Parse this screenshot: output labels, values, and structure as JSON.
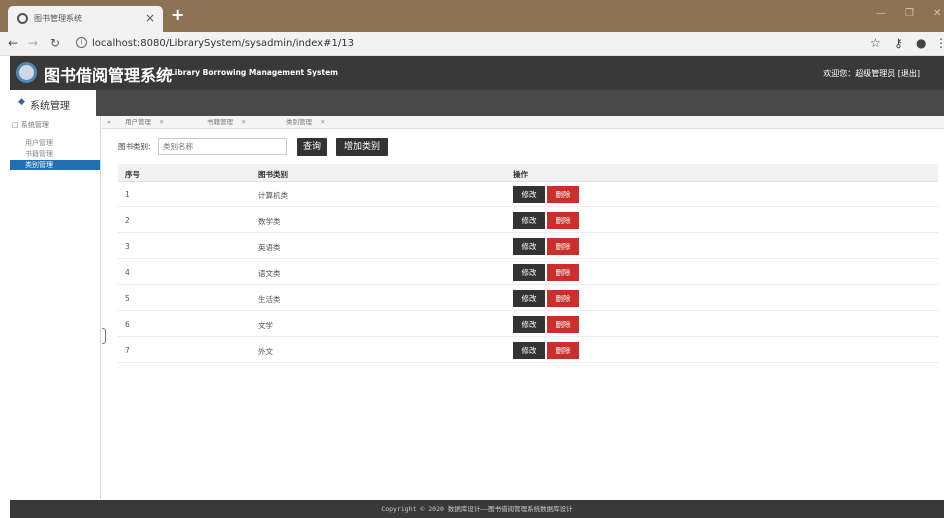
{
  "browser": {
    "tab_title": "图书管理系统",
    "url": "localhost:8080/LibrarySystem/sysadmin/index#1/13"
  },
  "app": {
    "title": "图书借阅管理系统",
    "subtitle": "Library Borrowing Management System",
    "welcome": "欢迎您：超级管理员 [退出]"
  },
  "topnav": {
    "label": "系统管理"
  },
  "sidebar": {
    "group": "系统管理",
    "items": [
      {
        "label": "用户管理"
      },
      {
        "label": "书籍管理"
      },
      {
        "label": "类别管理"
      }
    ]
  },
  "innertabs": [
    {
      "label": "用户管理"
    },
    {
      "label": "书籍管理"
    },
    {
      "label": "类别管理"
    }
  ],
  "search": {
    "label": "图书类别:",
    "placeholder": "类别名称",
    "query_button": "查询",
    "add_button": "增加类别"
  },
  "table": {
    "headers": [
      "序号",
      "图书类别",
      "操作"
    ],
    "edit_label": "修改",
    "delete_label": "删除",
    "rows": [
      {
        "id": "1",
        "category": "计算机类"
      },
      {
        "id": "2",
        "category": "数学类"
      },
      {
        "id": "3",
        "category": "英语类"
      },
      {
        "id": "4",
        "category": "语文类"
      },
      {
        "id": "5",
        "category": "生活类"
      },
      {
        "id": "6",
        "category": "文学"
      },
      {
        "id": "7",
        "category": "外文"
      }
    ]
  },
  "footer": "Copyright © 2020 数据库设计——图书借阅管理系统数据库设计",
  "colors": {
    "header_bg": "#393939",
    "accent_blue": "#1f6fb5",
    "delete_red": "#c9302c",
    "browser_frame": "#8c7355"
  }
}
